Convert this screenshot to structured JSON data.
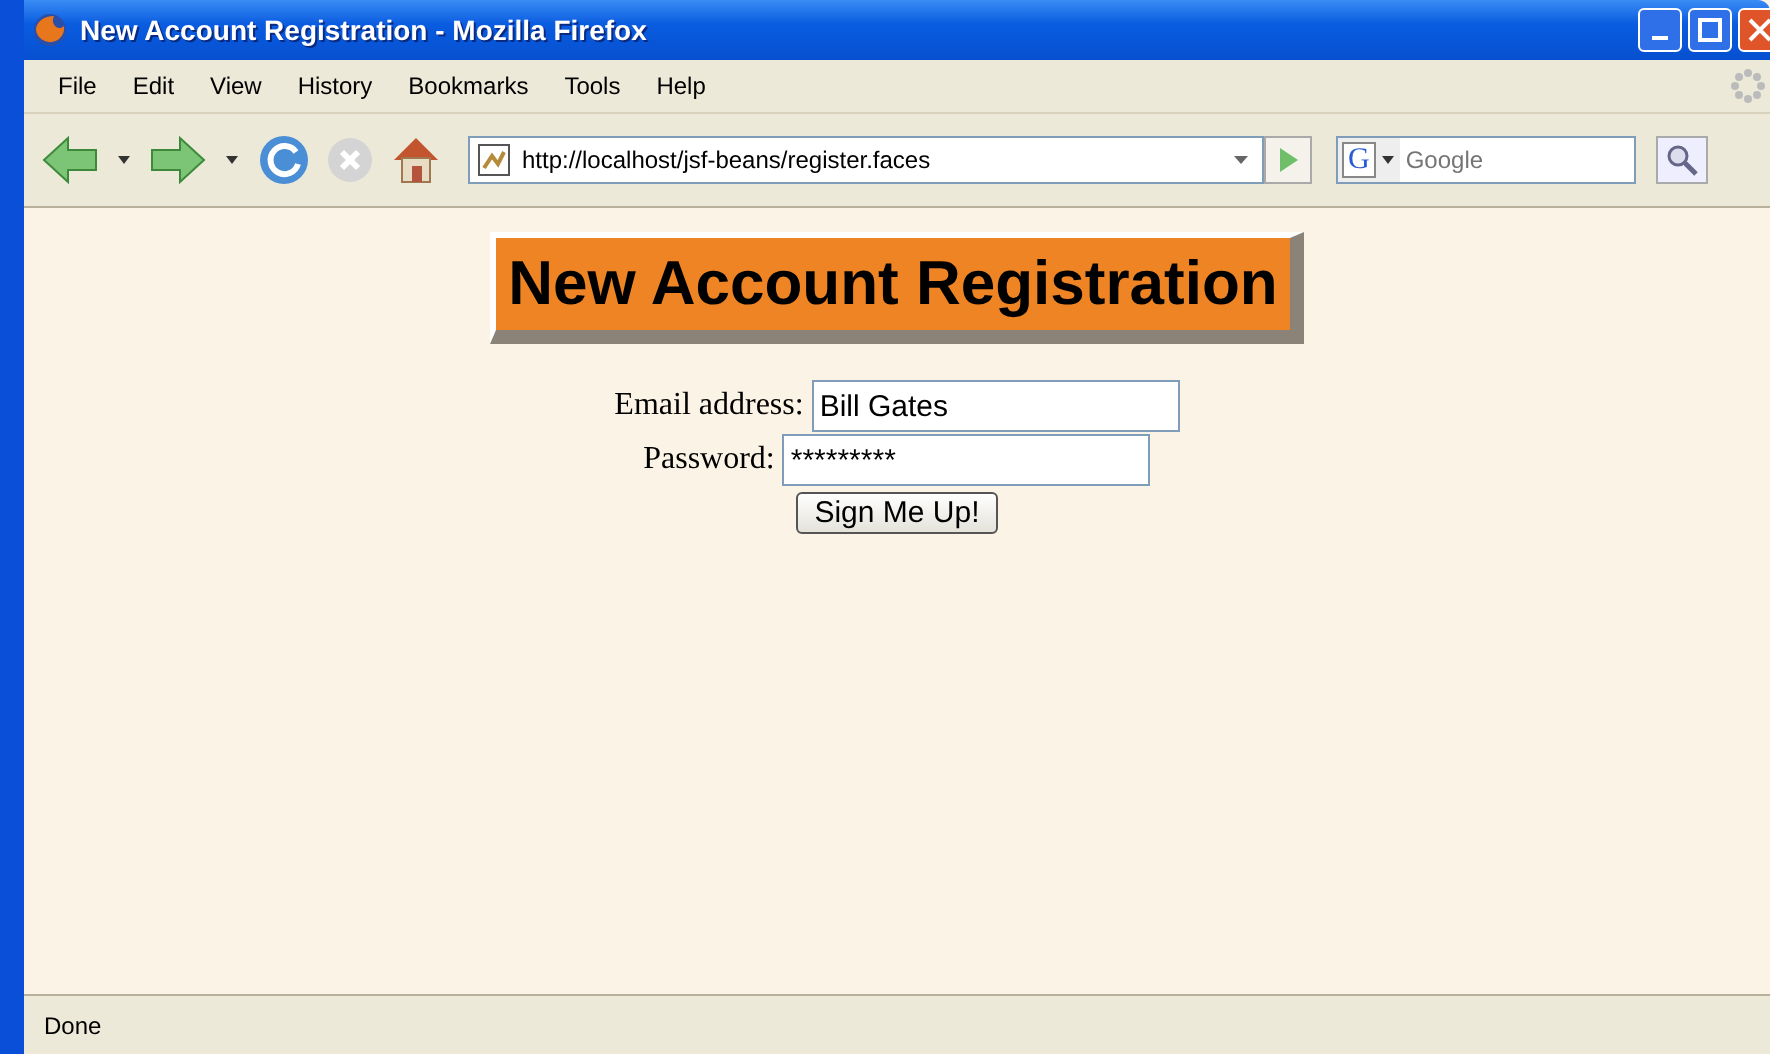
{
  "window": {
    "title": "New Account Registration - Mozilla Firefox"
  },
  "menu": [
    "File",
    "Edit",
    "View",
    "History",
    "Bookmarks",
    "Tools",
    "Help"
  ],
  "address_bar": {
    "url": "http://localhost/jsf-beans/register.faces"
  },
  "search": {
    "engine": "G",
    "placeholder": "Google"
  },
  "page": {
    "heading": "New Account Registration",
    "fields": [
      {
        "label": "Email address:",
        "value": "Bill Gates"
      },
      {
        "label": "Password:",
        "value": "*********"
      }
    ],
    "submit": "Sign Me Up!"
  },
  "status_bar": "Done"
}
